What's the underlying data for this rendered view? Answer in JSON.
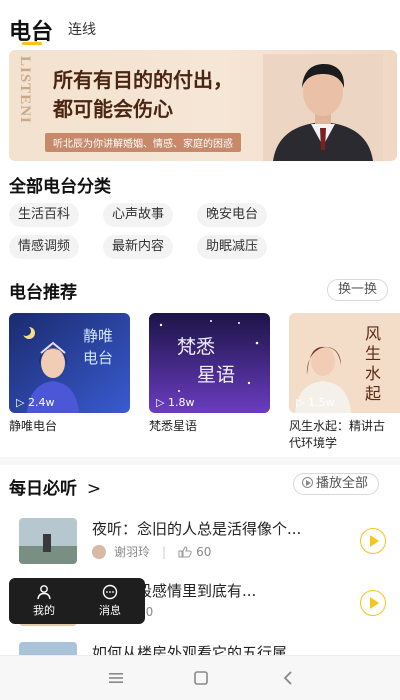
{
  "header": {
    "tab_active": "电台",
    "tab_inactive": "连线"
  },
  "banner": {
    "vertical_text": "LISTENI",
    "title_line1": "所有有目的的付出，",
    "title_line2": "都可能会伤心",
    "subtitle": "听北辰为你讲解婚姻、情感、家庭的困惑"
  },
  "categories": {
    "title": "全部电台分类",
    "chips": [
      "生活百科",
      "心声故事",
      "晚安电台",
      "情感调频",
      "最新内容",
      "助眠减压"
    ]
  },
  "recommend": {
    "title": "电台推荐",
    "switch_label": "换一换",
    "cards": [
      {
        "art_text": "静唯电台",
        "plays": "▷ 2.4w",
        "name": "静唯电台"
      },
      {
        "art_text": "梵悉星语",
        "plays": "▷ 1.8w",
        "name": "梵悉星语"
      },
      {
        "art_text": "风生水起",
        "plays": "▷ 1.5w",
        "name_line1": "风生水起：精讲古",
        "name_line2": "代环境学"
      }
    ]
  },
  "daily": {
    "title": "每日必听",
    "play_all": "播放全部",
    "items": [
      {
        "title": "夜听：念旧的人总是活得像个...",
        "author": "谢羽玲",
        "likes": "60"
      },
      {
        "title": "步在一段感情里到底有...",
        "likes": "20"
      },
      {
        "title": "如何从楼房外观看它的五行属..."
      }
    ]
  },
  "float_nav": {
    "mine": "我的",
    "messages": "消息"
  },
  "colors": {
    "accent": "#f5c518",
    "banner_text": "#4a2511",
    "chip_bg": "#f3f3f3"
  }
}
